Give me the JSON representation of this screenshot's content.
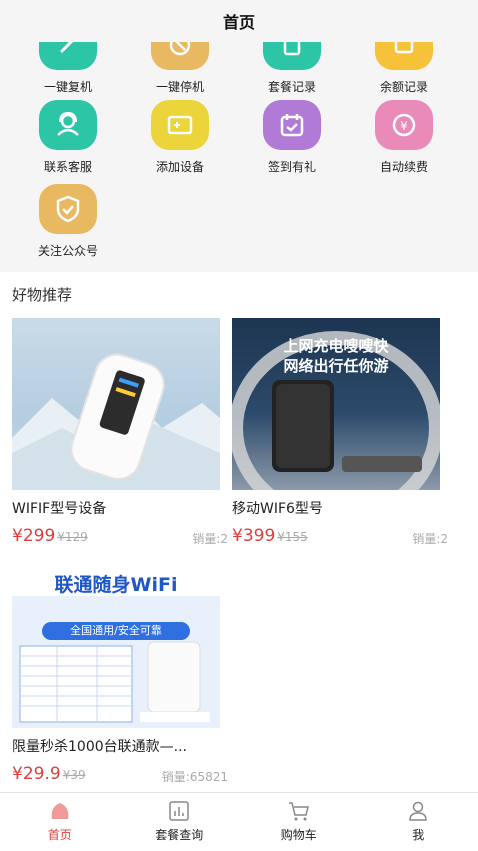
{
  "header": {
    "title": "首页"
  },
  "menu": {
    "items": [
      {
        "label": "一键复机",
        "icon": "restart-icon",
        "color": "#2cc5a6"
      },
      {
        "label": "一键停机",
        "icon": "stop-icon",
        "color": "#e9b962"
      },
      {
        "label": "套餐记录",
        "icon": "record-icon",
        "color": "#2cc5a6"
      },
      {
        "label": "余额记录",
        "icon": "balance-icon",
        "color": "#f5c23a"
      },
      {
        "label": "联系客服",
        "icon": "customer-service-icon",
        "color": "#2cc5a6"
      },
      {
        "label": "添加设备",
        "icon": "add-device-icon",
        "color": "#ecd43b"
      },
      {
        "label": "签到有礼",
        "icon": "calendar-icon",
        "color": "#b17ad6"
      },
      {
        "label": "自动续费",
        "icon": "auto-renew-icon",
        "color": "#e98ab8"
      },
      {
        "label": "关注公众号",
        "icon": "badge-icon",
        "color": "#e9b962"
      }
    ]
  },
  "recommend": {
    "title": "好物推荐",
    "products": [
      {
        "name": "WIFIF型号设备",
        "currency": "¥",
        "price": "299",
        "original": "¥129",
        "sales": "销量:2"
      },
      {
        "name": "移动WIF6型号",
        "currency": "¥",
        "price": "399",
        "original": "¥155",
        "sales": "销量:2",
        "banner_line1": "上网充电嗖嗖快",
        "banner_line2": "网络出行任你游"
      },
      {
        "name": "限量秒杀1000台联通款—...",
        "currency": "¥",
        "price": "29.9",
        "original": "¥39",
        "sales": "销量:65821",
        "banner_line1": "联通随身WiFi",
        "banner_line2": "全国通用/安全可靠"
      }
    ]
  },
  "tabbar": {
    "items": [
      {
        "label": "首页",
        "icon": "home-icon",
        "active": true
      },
      {
        "label": "套餐查询",
        "icon": "chart-icon",
        "active": false
      },
      {
        "label": "购物车",
        "icon": "cart-icon",
        "active": false
      },
      {
        "label": "我",
        "icon": "user-icon",
        "active": false
      }
    ]
  },
  "colors": {
    "accent": "#e23c3c",
    "background": "#f5f5f5"
  }
}
